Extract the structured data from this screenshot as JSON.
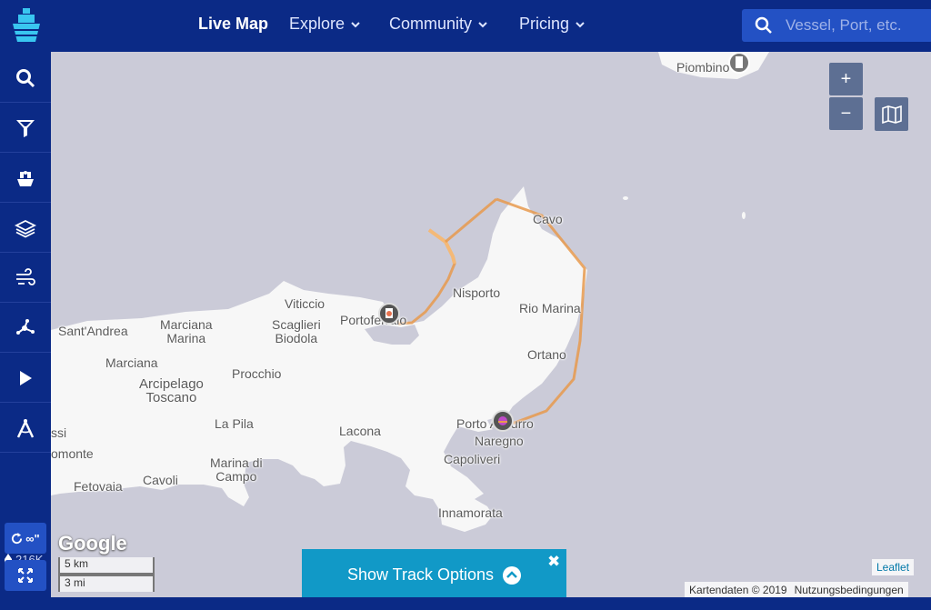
{
  "nav": {
    "live_map": "Live Map",
    "explore": "Explore",
    "community": "Community",
    "pricing": "Pricing"
  },
  "search": {
    "placeholder": "Vessel, Port, etc."
  },
  "sidebar": {
    "buttons": [
      "search-icon",
      "filter-icon",
      "fleet-icon",
      "layers-icon",
      "weather-icon",
      "network-icon",
      "play-icon",
      "measure-icon"
    ],
    "vessel_count": "216K",
    "refresh_label": "∞\"",
    "fullscreen_icon": "fullscreen-icon"
  },
  "map": {
    "zoom_in": "+",
    "zoom_out": "−",
    "provider": "Google",
    "scale_km": "5 km",
    "scale_mi": "3 mi",
    "leaflet": "Leaflet",
    "attribution": "Kartendaten © 2019",
    "terms": "Nutzungsbedingungen",
    "places": {
      "piombino": "Piombino",
      "cavo": "Cavo",
      "viticcio": "Viticcio",
      "nisporto": "Nisporto",
      "rio_marina": "Rio Marina",
      "portoferraio": "Portoferraio",
      "scaglieri_biodola": "Scaglieri\nBiodola",
      "santandrea": "Sant'Andrea",
      "marciana_marina": "Marciana\nMarina",
      "marciana": "Marciana",
      "arcipelago": "Arcipelago\nToscano",
      "procchio": "Procchio",
      "ortano": "Ortano",
      "la_pila": "La Pila",
      "lacona": "Lacona",
      "porto_azzurro": "Porto Azzurro",
      "naregno": "Naregno",
      "capoliveri": "Capoliveri",
      "ssi": "ssi",
      "pomonte": "omonte",
      "fetovaia": "Fetovaia",
      "cavoli": "Cavoli",
      "marina_di_campo": "Marina di\nCampo",
      "innamorata": "Innamorata"
    }
  },
  "track": {
    "label": "Show Track Options",
    "close": "✖"
  },
  "colors": {
    "brand": "#0b2a86",
    "accent": "#1199c7",
    "track": "#e89a4e",
    "sea": "#cbcbd8",
    "land": "#f7f7f7"
  }
}
